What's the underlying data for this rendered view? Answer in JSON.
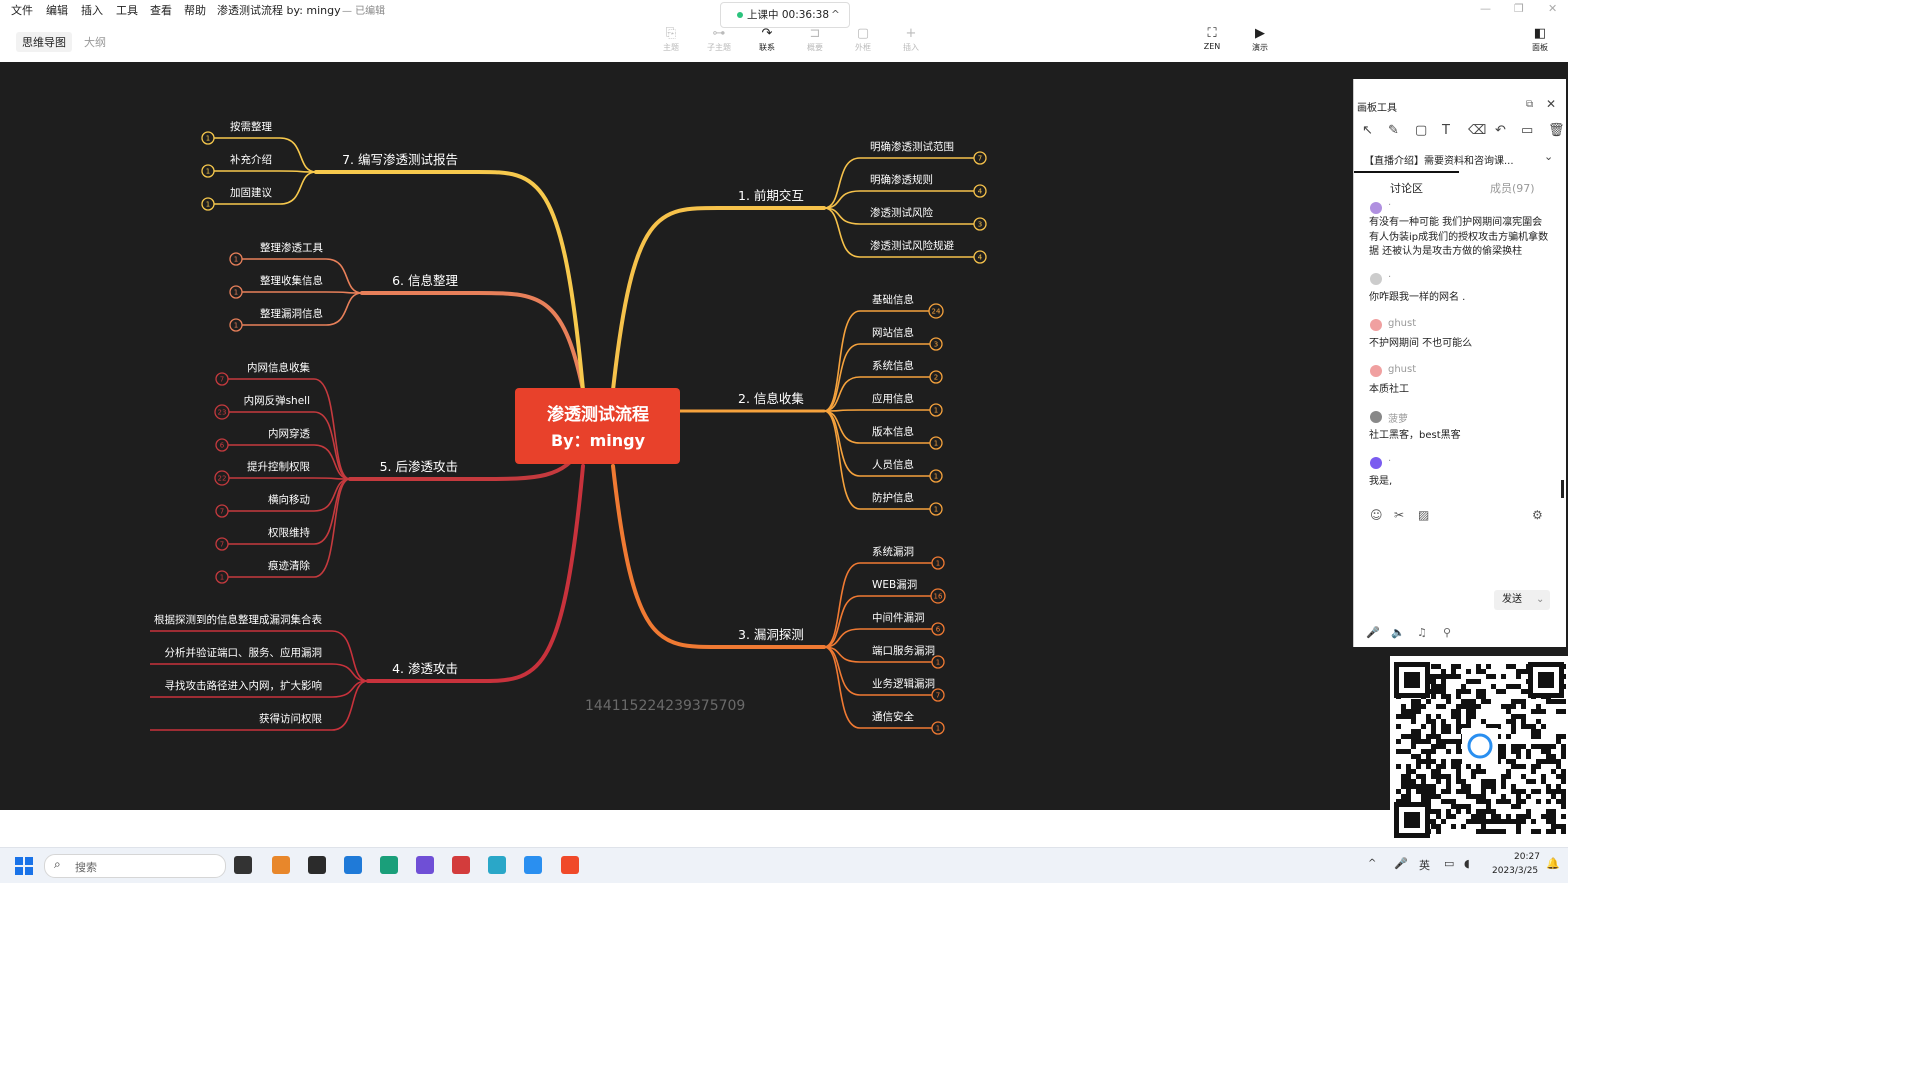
{
  "menu": [
    "文件",
    "编辑",
    "插入",
    "工具",
    "查看",
    "帮助"
  ],
  "doc_title": "渗透测试流程 by: mingy",
  "doc_state": "— 已编辑",
  "view_tabs": {
    "mind": "思维导图",
    "outline": "大纲"
  },
  "live": {
    "status": "上课中 00:36:38",
    "caret": "^"
  },
  "toolbar": [
    {
      "label": "主题",
      "icon": "⎘"
    },
    {
      "label": "子主题",
      "icon": "⊶"
    },
    {
      "label": "联系",
      "icon": "↷"
    },
    {
      "label": "概要",
      "icon": "⊐"
    },
    {
      "label": "外框",
      "icon": "▢"
    },
    {
      "label": "插入",
      "icon": "+"
    }
  ],
  "right_tools": [
    {
      "label": "ZEN",
      "icon": "⛶"
    },
    {
      "label": "演示",
      "icon": "▶"
    },
    {
      "label": "面板",
      "icon": "◧"
    }
  ],
  "window_controls": [
    "—",
    "❐",
    "✕"
  ],
  "mindmap": {
    "center_line1": "渗透测试流程",
    "center_line2": "By：mingy",
    "branches": [
      {
        "title": "1. 前期交互",
        "children": [
          {
            "label": "明确渗透测试范围",
            "count": "7"
          },
          {
            "label": "明确渗透规则",
            "count": "4"
          },
          {
            "label": "渗透测试风险",
            "count": "3"
          },
          {
            "label": "渗透测试风险规避",
            "count": "4"
          }
        ]
      },
      {
        "title": "2. 信息收集",
        "children": [
          {
            "label": "基础信息",
            "count": "24"
          },
          {
            "label": "网站信息",
            "count": "3"
          },
          {
            "label": "系统信息",
            "count": "2"
          },
          {
            "label": "应用信息",
            "count": "1"
          },
          {
            "label": "版本信息",
            "count": "1"
          },
          {
            "label": "人员信息",
            "count": "1"
          },
          {
            "label": "防护信息",
            "count": "1"
          }
        ]
      },
      {
        "title": "3. 漏洞探测",
        "children": [
          {
            "label": "系统漏洞",
            "count": "1"
          },
          {
            "label": "WEB漏洞",
            "count": "16"
          },
          {
            "label": "中间件漏洞",
            "count": "6"
          },
          {
            "label": "端口服务漏洞",
            "count": "1"
          },
          {
            "label": "业务逻辑漏洞",
            "count": "7"
          },
          {
            "label": "通信安全",
            "count": "1"
          }
        ]
      },
      {
        "title": "4. 渗透攻击",
        "children": [
          {
            "label": "根据探测到的信息整理成漏洞集合表",
            "count": ""
          },
          {
            "label": "分析并验证端口、服务、应用漏洞",
            "count": ""
          },
          {
            "label": "寻找攻击路径进入内网，扩大影响",
            "count": ""
          },
          {
            "label": "获得访问权限",
            "count": ""
          }
        ]
      },
      {
        "title": "5. 后渗透攻击",
        "children": [
          {
            "label": "内网信息收集",
            "count": "7"
          },
          {
            "label": "内网反弹shell",
            "count": "23"
          },
          {
            "label": "内网穿透",
            "count": "6"
          },
          {
            "label": "提升控制权限",
            "count": "22"
          },
          {
            "label": "横向移动",
            "count": "7"
          },
          {
            "label": "权限维持",
            "count": "7"
          },
          {
            "label": "痕迹清除",
            "count": "1"
          }
        ]
      },
      {
        "title": "6. 信息整理",
        "children": [
          {
            "label": "整理渗透工具",
            "count": "1"
          },
          {
            "label": "整理收集信息",
            "count": "1"
          },
          {
            "label": "整理漏洞信息",
            "count": "1"
          }
        ]
      },
      {
        "title": "7. 编写渗透测试报告",
        "children": [
          {
            "label": "按需整理",
            "count": "1"
          },
          {
            "label": "补充介绍",
            "count": "1"
          },
          {
            "label": "加固建议",
            "count": "1"
          }
        ]
      }
    ]
  },
  "watermark": "144115224239375709",
  "panel": {
    "title": "画板工具",
    "tool_icons": [
      "↖",
      "✎",
      "▢",
      "T",
      "⌫",
      "↶",
      "▭",
      "🗑"
    ],
    "promo": "【直播介绍】需要资料和咨询课...",
    "tabs": {
      "discuss": "讨论区",
      "members": "成员(97)"
    },
    "messages": [
      {
        "name": "·",
        "text": "有没有一种可能 我们护网期间凛宪圍会有人伪装ip成我们的授权攻击方骗机拿数据 还被认为是攻击方做的偷梁换柱",
        "avatar": "#b090e0"
      },
      {
        "name": "·",
        "text": "你咋跟我一样的网名 .",
        "avatar": "#cccccc"
      },
      {
        "name": "ghust",
        "text": "不护网期间 不也可能么",
        "avatar": "#f0a0a0"
      },
      {
        "name": "ghust",
        "text": "本质社工",
        "avatar": "#f0a0a0"
      },
      {
        "name": "菠萝",
        "text": "社工黑客，best黑客",
        "avatar": "#888888"
      },
      {
        "name": "·",
        "text": "我是,",
        "avatar": "#7a5cf0"
      }
    ],
    "input_icons": [
      "☺",
      "✂",
      "▨",
      "⚙"
    ],
    "send": "发送",
    "bottom_icons": [
      "🎤",
      "🔈",
      "♫",
      "⚲"
    ]
  },
  "taskbar": {
    "search_label": "搜索",
    "apps": [
      {
        "name": "file-explorer",
        "color": "#333333"
      },
      {
        "name": "sublime",
        "color": "#e8872b"
      },
      {
        "name": "terminal",
        "color": "#2b2b2b"
      },
      {
        "name": "vscode",
        "color": "#1f7ad8"
      },
      {
        "name": "edge",
        "color": "#1a9f7a"
      },
      {
        "name": "obsidian",
        "color": "#6f4fd6"
      },
      {
        "name": "davinci",
        "color": "#d33c3c"
      },
      {
        "name": "onenote",
        "color": "#2aa7c8"
      },
      {
        "name": "feishu",
        "color": "#2a8ff0"
      },
      {
        "name": "xmind",
        "color": "#f04a2a"
      }
    ],
    "ime": "英",
    "time": "20:27",
    "date": "2023/3/25"
  }
}
